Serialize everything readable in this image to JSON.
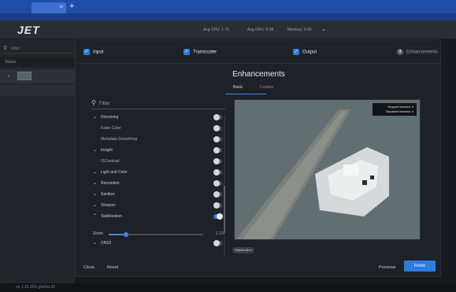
{
  "browser": {
    "tab_close": "×",
    "new_tab": "+"
  },
  "app": {
    "logo": "JET",
    "stats": {
      "cpu": "Avg CPU: 1.75",
      "gpu": "Avg GPU: 0.56",
      "memory": "Memory: 0.00"
    },
    "stats_menu_icon": "chevron-down-icon"
  },
  "sidebar": {
    "filter_placeholder": "Filter",
    "status_header": "Status",
    "row_bullet": "•"
  },
  "wizard": {
    "steps": [
      {
        "label": "Input",
        "state": "done"
      },
      {
        "label": "Transcoder",
        "state": "done"
      },
      {
        "label": "Output",
        "state": "done"
      },
      {
        "label": "Enhancements",
        "state": "current",
        "number": "4"
      }
    ],
    "title": "Enhancements",
    "tabs": [
      {
        "label": "Basic",
        "active": true
      },
      {
        "label": "Custom",
        "active": false
      }
    ],
    "filter_placeholder": "Filter",
    "enhancements": [
      {
        "label": "Denoising",
        "expandable": true,
        "enabled": false
      },
      {
        "label": "False Color",
        "expandable": false,
        "enabled": false
      },
      {
        "label": "Metadata Smoothing",
        "expandable": false,
        "enabled": false
      },
      {
        "label": "Insight",
        "expandable": true,
        "enabled": false
      },
      {
        "label": "ISContrast",
        "expandable": false,
        "enabled": false
      },
      {
        "label": "Light and Color",
        "expandable": true,
        "enabled": false
      },
      {
        "label": "Resolution",
        "expandable": true,
        "enabled": false
      },
      {
        "label": "Sanitize",
        "expandable": true,
        "enabled": false
      },
      {
        "label": "Sharpen",
        "expandable": true,
        "enabled": false
      },
      {
        "label": "Stabilization",
        "expandable": true,
        "expanded": true,
        "enabled": true
      },
      {
        "label": "DNS3",
        "expandable": true,
        "enabled": false
      }
    ],
    "zoom": {
      "label": "Zoom",
      "value": "1.10",
      "fraction": 0.18
    },
    "preview_overlay": [
      "Dropped frames/s: 0",
      "Discarded frames/s: 0"
    ],
    "active_chip": "Stabilization",
    "footer": {
      "close": "Close",
      "reset": "Reset",
      "previous": "Previous",
      "finish": "Finish"
    }
  },
  "statusbar": {
    "version": "on 1.15.263-g3e0ec33"
  },
  "colors": {
    "accent": "#2b7de0",
    "header": "#1f4ea8"
  }
}
